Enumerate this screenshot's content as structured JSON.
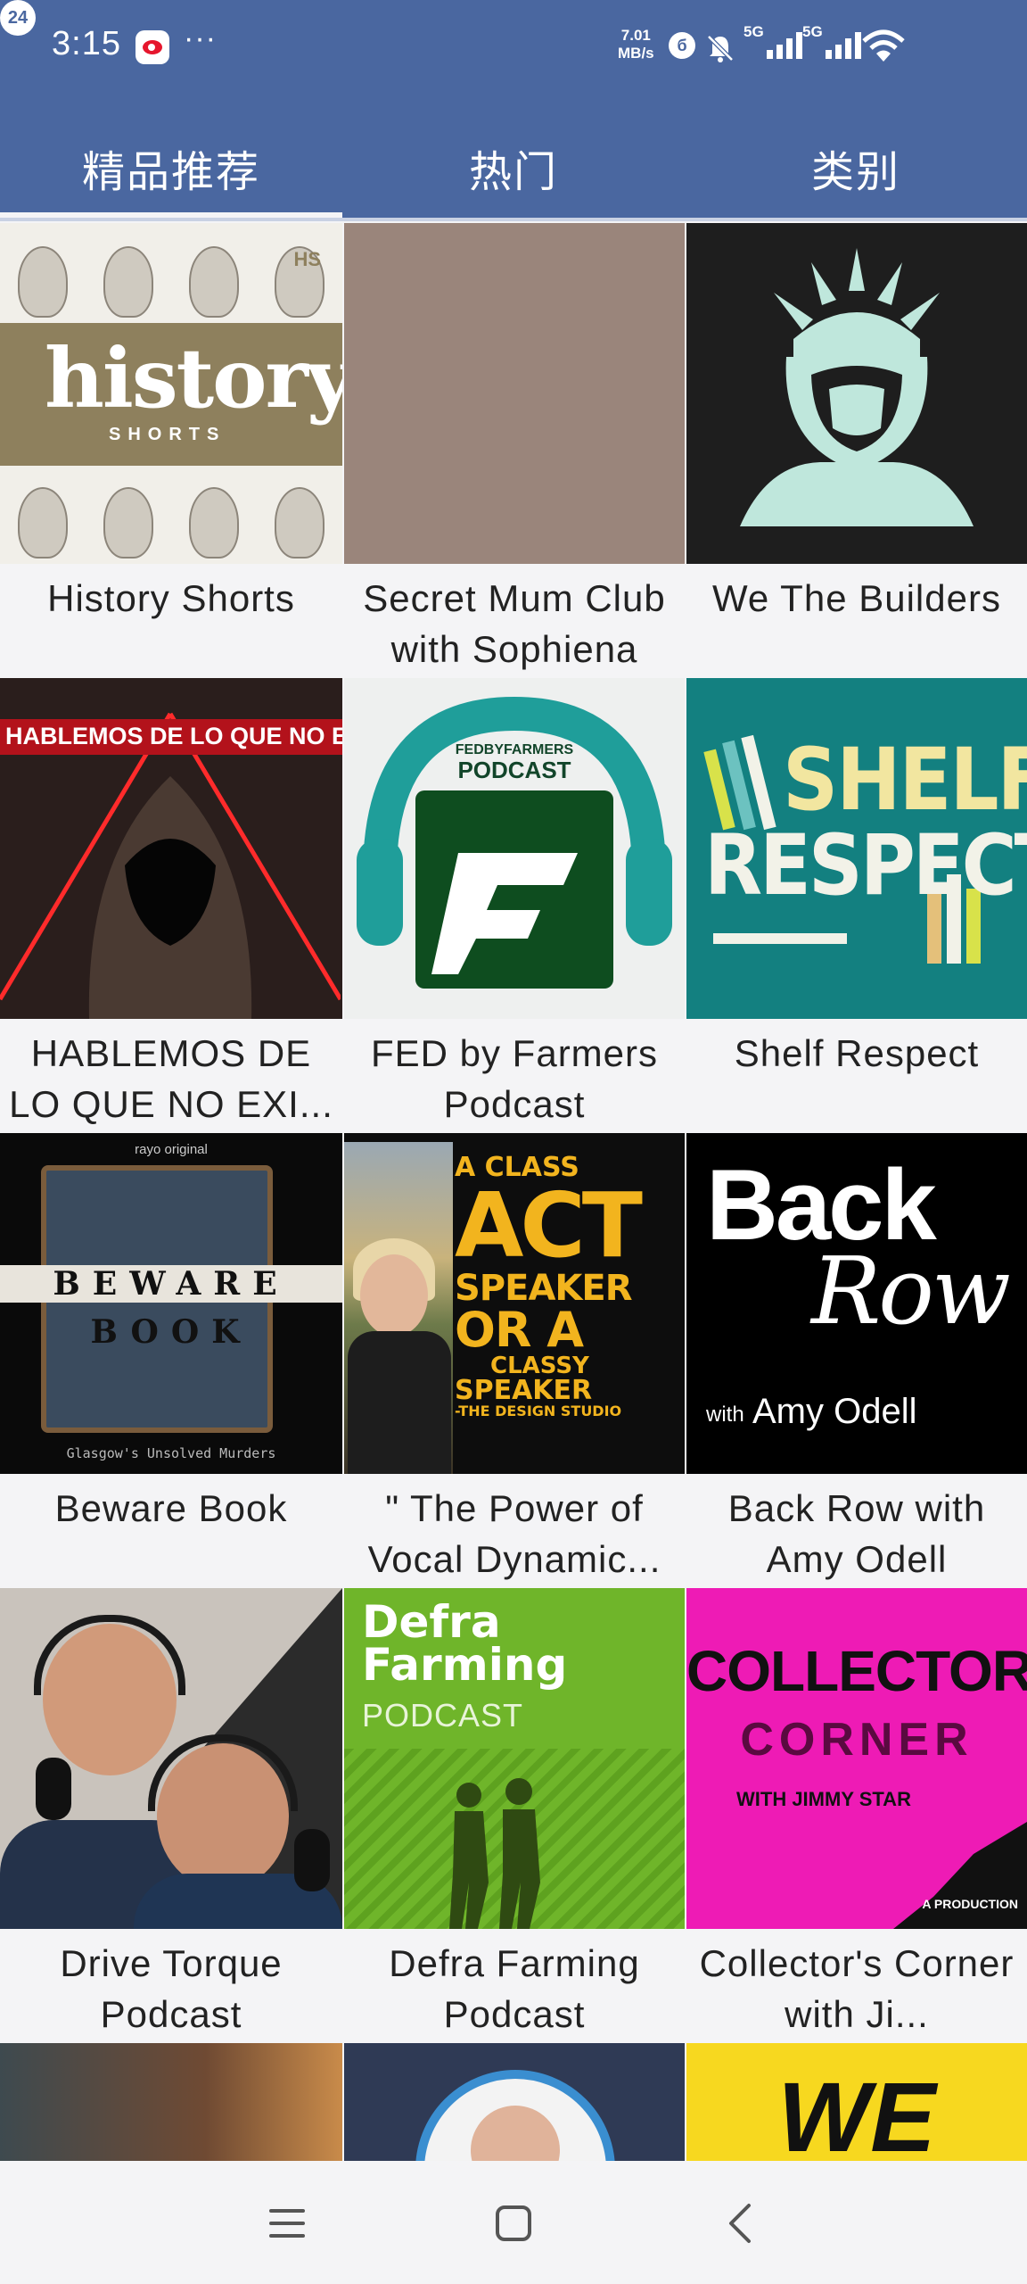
{
  "status_bar": {
    "time": "3:15",
    "more": "···",
    "net_speed_value": "7.01",
    "net_speed_unit": "MB/s",
    "bluetooth": "б",
    "signal_1_label": "5G",
    "signal_2_label": "5G",
    "battery": "24"
  },
  "tabs": [
    {
      "label": "精品推荐",
      "selected": true
    },
    {
      "label": "热门",
      "selected": false
    },
    {
      "label": "类别",
      "selected": false
    }
  ],
  "grid": {
    "items": [
      {
        "title": "History Shorts"
      },
      {
        "title": "Secret Mum Club with Sophiena"
      },
      {
        "title": "We The Builders"
      },
      {
        "title": "HABLEMOS DE LO QUE NO EXI..."
      },
      {
        "title": "FED by Farmers Podcast"
      },
      {
        "title": "Shelf Respect"
      },
      {
        "title": "Beware Book"
      },
      {
        "title": "\" The Power of Vocal Dynamic..."
      },
      {
        "title": "Back Row with Amy Odell"
      },
      {
        "title": "Drive Torque Podcast"
      },
      {
        "title": "Defra Farming Podcast"
      },
      {
        "title": "Collector's Corner with Ji..."
      }
    ]
  },
  "covers": {
    "history_logo": "history",
    "history_sub": "SHORTS",
    "history_badge": "HS",
    "hablemos_banner": "HABLEMOS DE LO QUE NO EXISTE",
    "fed_top": "FEDBYFARMERS",
    "fed_bottom": "PODCAST",
    "shelf_line1": "SHELF",
    "shelf_line2": "RESPECT",
    "beware_brand": "rayo original",
    "beware_word1": "BEWARE",
    "beware_word2": "BOOK",
    "beware_sub": "Glasgow's Unsolved Murders",
    "power_l1": "A CLASS",
    "power_l2": "ACT",
    "power_l3": "SPEAKER",
    "power_l4": "OR A",
    "power_l5": "CLASSY",
    "power_l6": "SPEAKER",
    "power_l7": "-THE DESIGN STUDIO",
    "backrow_back": "Back",
    "backrow_row": "Row",
    "backrow_with": "with",
    "backrow_amy": "Amy Odell",
    "defra_t1a": "Defra",
    "defra_t1b": "Farming",
    "defra_t2": "PODCAST",
    "collector_t1": "COLLECTOR'S",
    "collector_t2": "CORNER",
    "collector_t3": "WITH JIMMY STAR",
    "collector_prod": "A PRODUCTION",
    "p3_text": "WE"
  },
  "colors": {
    "header": "#4a67a0",
    "background": "#f4f4f6",
    "text": "#222222"
  },
  "navbar": {
    "menu_icon": "menu-icon",
    "home_icon": "home-icon",
    "back_icon": "back-icon"
  }
}
